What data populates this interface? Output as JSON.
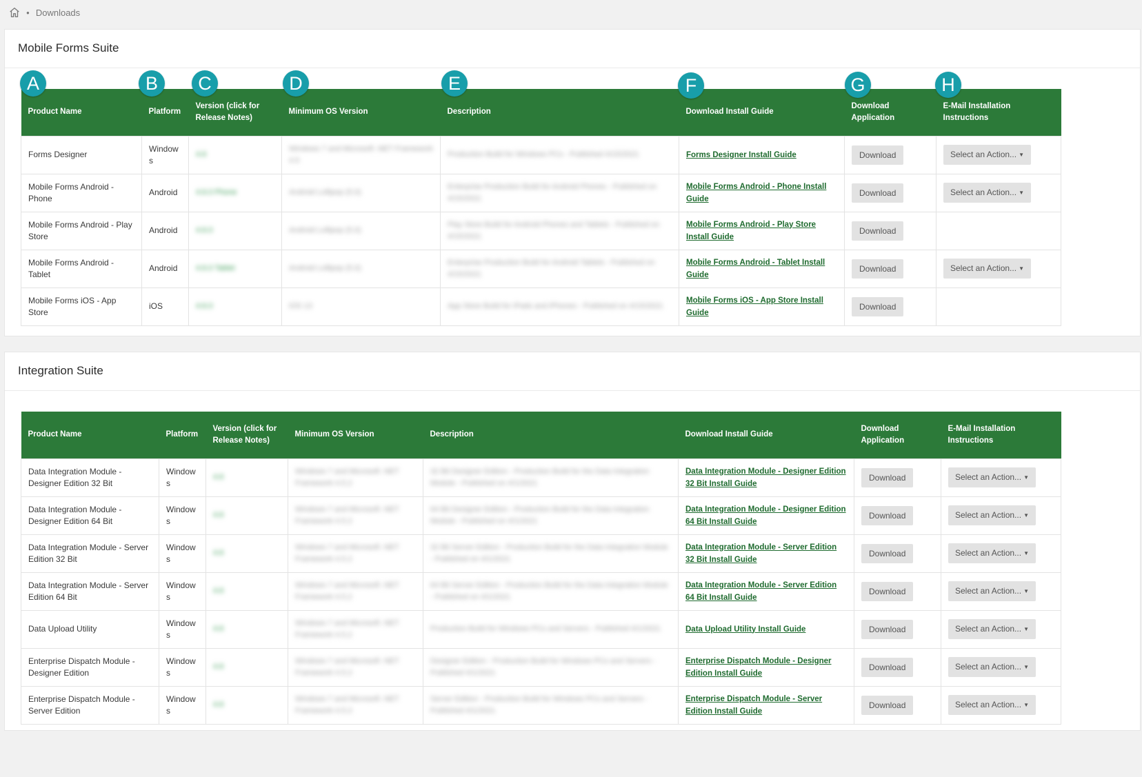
{
  "breadcrumb": {
    "current": "Downloads"
  },
  "columns": [
    "Product Name",
    "Platform",
    "Version (click for Release Notes)",
    "Minimum OS Version",
    "Description",
    "Download Install Guide",
    "Download Application",
    "E-Mail Installation Instructions"
  ],
  "markers": [
    "A",
    "B",
    "C",
    "D",
    "E",
    "F",
    "G",
    "H"
  ],
  "download_label": "Download",
  "select_label": "Select an Action...",
  "mobile": {
    "title": "Mobile Forms Suite",
    "rows": [
      {
        "product": "Forms Designer",
        "platform": "Windows",
        "version": "4.6",
        "min_os": "Windows 7 and Microsoft .NET Framework 4.5",
        "description": "Production Build for Windows PCs - Published 4/15/2021",
        "guide": "Forms Designer Install Guide",
        "email": true
      },
      {
        "product": "Mobile Forms Android - Phone",
        "platform": "Android",
        "version": "4.6.0 Phone",
        "min_os": "Android Lollipop (5.0)",
        "description": "Enterprise Production Build for Android Phones - Published on 4/15/2021",
        "guide": "Mobile Forms Android - Phone Install Guide",
        "email": true
      },
      {
        "product": "Mobile Forms Android - Play Store",
        "platform": "Android",
        "version": "4.6.0",
        "min_os": "Android Lollipop (5.0)",
        "description": "Play Store Build for Android Phones and Tablets - Published on 4/15/2021",
        "guide": "Mobile Forms Android - Play Store Install Guide",
        "email": false
      },
      {
        "product": "Mobile Forms Android - Tablet",
        "platform": "Android",
        "version": "4.6.0 Tablet",
        "min_os": "Android Lollipop (5.0)",
        "description": "Enterprise Production Build for Android Tablets - Published on 4/15/2021",
        "guide": "Mobile Forms Android - Tablet Install Guide",
        "email": true
      },
      {
        "product": "Mobile Forms iOS - App Store",
        "platform": "iOS",
        "version": "4.6.0",
        "min_os": "iOS 13",
        "description": "App Store Build for iPads and iPhones - Published on 4/15/2021",
        "guide": "Mobile Forms iOS - App Store Install Guide",
        "email": false
      }
    ]
  },
  "integration": {
    "title": "Integration Suite",
    "rows": [
      {
        "product": "Data Integration Module - Designer Edition 32 Bit",
        "platform": "Windows",
        "version": "4.6",
        "min_os": "Windows 7 and Microsoft .NET Framework 4.5.2",
        "description": "32 Bit Designer Edition - Production Build for the Data Integration Module - Published on 4/1/2021",
        "guide": "Data Integration Module - Designer Edition 32 Bit Install Guide",
        "email": true
      },
      {
        "product": "Data Integration Module - Designer Edition 64 Bit",
        "platform": "Windows",
        "version": "4.6",
        "min_os": "Windows 7 and Microsoft .NET Framework 4.5.2",
        "description": "64 Bit Designer Edition - Production Build for the Data Integration Module - Published on 4/1/2021",
        "guide": "Data Integration Module - Designer Edition 64 Bit Install Guide",
        "email": true
      },
      {
        "product": "Data Integration Module - Server Edition 32 Bit",
        "platform": "Windows",
        "version": "4.6",
        "min_os": "Windows 7 and Microsoft .NET Framework 4.5.2",
        "description": "32 Bit Server Edition - Production Build for the Data Integration Module - Published on 4/1/2021",
        "guide": "Data Integration Module - Server Edition 32 Bit Install Guide",
        "email": true
      },
      {
        "product": "Data Integration Module - Server Edition 64 Bit",
        "platform": "Windows",
        "version": "4.6",
        "min_os": "Windows 7 and Microsoft .NET Framework 4.5.2",
        "description": "64 Bit Server Edition - Production Build for the Data Integration Module - Published on 4/1/2021",
        "guide": "Data Integration Module - Server Edition 64 Bit Install Guide",
        "email": true
      },
      {
        "product": "Data Upload Utility",
        "platform": "Windows",
        "version": "4.6",
        "min_os": "Windows 7 and Microsoft .NET Framework 4.5.2",
        "description": "Production Build for Windows PCs and Servers - Published 4/1/2021",
        "guide": "Data Upload Utility Install Guide",
        "email": true
      },
      {
        "product": "Enterprise Dispatch Module - Designer Edition",
        "platform": "Windows",
        "version": "4.6",
        "min_os": "Windows 7 and Microsoft .NET Framework 4.5.2",
        "description": "Designer Edition - Production Build for Windows PCs and Servers - Published 4/1/2021",
        "guide": "Enterprise Dispatch Module - Designer Edition Install Guide",
        "email": true
      },
      {
        "product": "Enterprise Dispatch Module - Server Edition",
        "platform": "Windows",
        "version": "4.6",
        "min_os": "Windows 7 and Microsoft .NET Framework 4.5.2",
        "description": "Server Edition - Production Build for Windows PCs and Servers - Published 4/1/2021",
        "guide": "Enterprise Dispatch Module - Server Edition Install Guide",
        "email": true
      }
    ]
  }
}
